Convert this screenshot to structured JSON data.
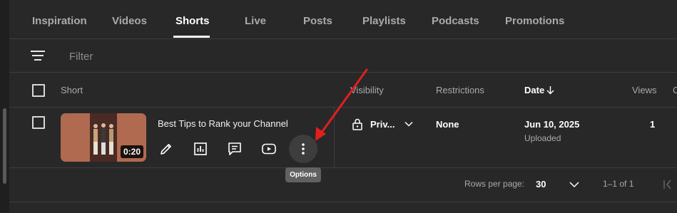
{
  "tabs": [
    {
      "label": "Inspiration"
    },
    {
      "label": "Videos"
    },
    {
      "label": "Shorts"
    },
    {
      "label": "Live"
    },
    {
      "label": "Posts"
    },
    {
      "label": "Playlists"
    },
    {
      "label": "Podcasts"
    },
    {
      "label": "Promotions"
    }
  ],
  "active_tab": "Shorts",
  "filter": {
    "placeholder": "Filter"
  },
  "table": {
    "headers": {
      "short": "Short",
      "visibility": "Visibility",
      "restrictions": "Restrictions",
      "date": "Date",
      "views": "Views",
      "comments_truncated": "C"
    },
    "sort": {
      "column": "date",
      "direction": "down"
    },
    "rows": [
      {
        "title": "Best Tips to Rank your Channel",
        "duration": "0:20",
        "visibility": "Priv...",
        "restrictions": "None",
        "date": "Jun 10, 2025",
        "date_status": "Uploaded",
        "views": "1"
      }
    ],
    "row_actions": [
      "edit-icon",
      "analytics-icon",
      "comments-icon",
      "youtube-icon",
      "more-options-icon"
    ]
  },
  "tooltip": {
    "text": "Options"
  },
  "annotation": {
    "arrow_color": "#e01f1f"
  },
  "pagination": {
    "rows_per_page_label": "Rows per page:",
    "rows_per_page_value": "30",
    "range": "1–1 of 1"
  },
  "colors": {
    "background": "#282828",
    "text_primary": "#ffffff",
    "text_secondary": "#aaaaaa",
    "divider": "#3e3e3e"
  }
}
